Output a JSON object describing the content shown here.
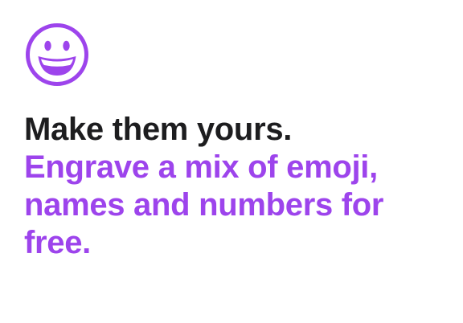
{
  "colors": {
    "accent": "#9d44ec",
    "text_dark": "#1d1d1f",
    "background": "#ffffff"
  },
  "icon": {
    "name": "grinning-face-icon"
  },
  "headline": {
    "lead": "Make them yours.",
    "sub_line_1": "Engrave a mix of emoji,",
    "sub_line_2": "names and numbers for",
    "sub_line_3": "free."
  }
}
